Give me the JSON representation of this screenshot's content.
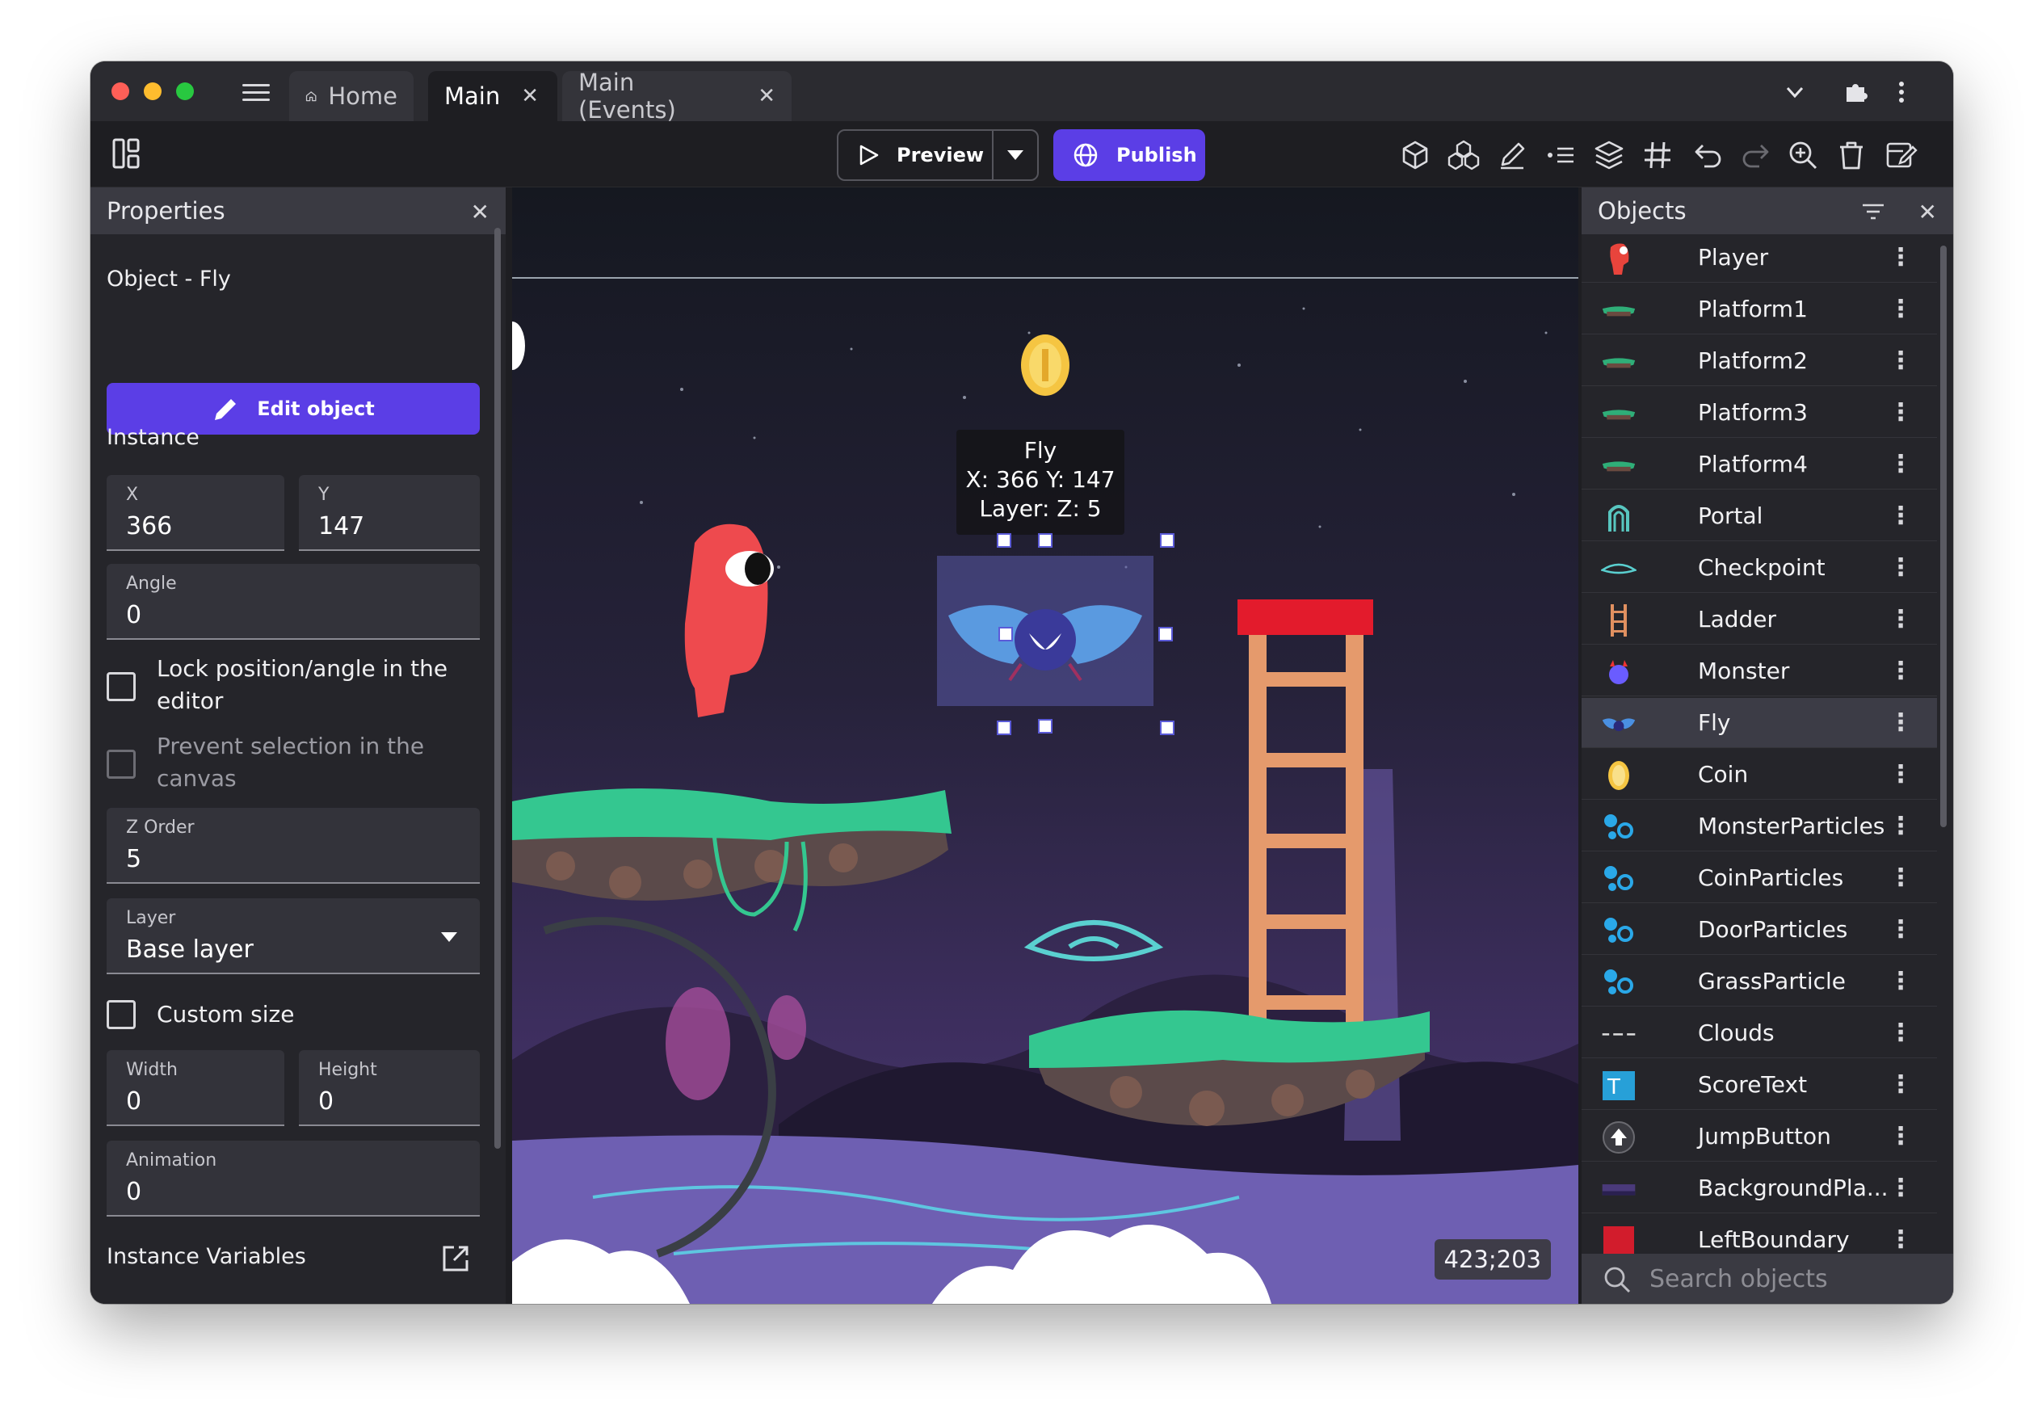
{
  "tabs": [
    {
      "label": "Home"
    },
    {
      "label": "Main"
    },
    {
      "label": "Main (Events)"
    }
  ],
  "toolbar": {
    "preview_label": "Preview",
    "publish_label": "Publish"
  },
  "properties": {
    "title": "Properties",
    "object_label": "Object  - Fly",
    "edit_object_label": "Edit object",
    "instance_label": "Instance",
    "x_label": "X",
    "x_value": "366",
    "y_label": "Y",
    "y_value": "147",
    "angle_label": "Angle",
    "angle_value": "0",
    "lock_label": "Lock position/angle in the editor",
    "prevent_label": "Prevent selection in the canvas",
    "z_label": "Z Order",
    "z_value": "5",
    "layer_label": "Layer",
    "layer_value": "Base layer",
    "custom_size_label": "Custom size",
    "width_label": "Width",
    "width_value": "0",
    "height_label": "Height",
    "height_value": "0",
    "animation_label": "Animation",
    "animation_value": "0",
    "instance_vars_label": "Instance Variables"
  },
  "canvas": {
    "tooltip_name": "Fly",
    "tooltip_pos": "X: 366  Y: 147",
    "tooltip_layer": "Layer:   Z: 5",
    "cursor_coords": "423;203"
  },
  "objects": {
    "title": "Objects",
    "search_placeholder": "Search objects",
    "items": [
      {
        "name": "Player",
        "icon": "player-icon",
        "color": "#e8443c"
      },
      {
        "name": "Platform1",
        "icon": "platform-icon",
        "color": "#2fae78"
      },
      {
        "name": "Platform2",
        "icon": "platform-icon",
        "color": "#2fae78"
      },
      {
        "name": "Platform3",
        "icon": "platform-icon",
        "color": "#2fae78"
      },
      {
        "name": "Platform4",
        "icon": "platform-icon",
        "color": "#2fae78"
      },
      {
        "name": "Portal",
        "icon": "portal-icon",
        "color": "#58c6c0"
      },
      {
        "name": "Checkpoint",
        "icon": "checkpoint-icon",
        "color": "#5ad0d0"
      },
      {
        "name": "Ladder",
        "icon": "ladder-icon",
        "color": "#e09060"
      },
      {
        "name": "Monster",
        "icon": "monster-icon",
        "color": "#6a5cff"
      },
      {
        "name": "Fly",
        "icon": "fly-icon",
        "color": "#4a90e2"
      },
      {
        "name": "Coin",
        "icon": "coin-icon",
        "color": "#f5c542"
      },
      {
        "name": "MonsterParticles",
        "icon": "particles-icon",
        "color": "#2aa8e8"
      },
      {
        "name": "CoinParticles",
        "icon": "particles-icon",
        "color": "#2aa8e8"
      },
      {
        "name": "DoorParticles",
        "icon": "particles-icon",
        "color": "#2aa8e8"
      },
      {
        "name": "GrassParticle",
        "icon": "particles-icon",
        "color": "#2aa8e8"
      },
      {
        "name": "Clouds",
        "icon": "clouds-icon",
        "color": "#dddddd"
      },
      {
        "name": "ScoreText",
        "icon": "text-icon",
        "color": "#27a0d8"
      },
      {
        "name": "JumpButton",
        "icon": "jump-icon",
        "color": "#ffffff"
      },
      {
        "name": "BackgroundPla...",
        "icon": "background-icon",
        "color": "#4a3a7a"
      },
      {
        "name": "LeftBoundary",
        "icon": "boundary-icon",
        "color": "#d21c2c"
      }
    ]
  },
  "colors": {
    "accent": "#5b3ee6",
    "panel": "#25252a",
    "header": "#3a3a42"
  }
}
